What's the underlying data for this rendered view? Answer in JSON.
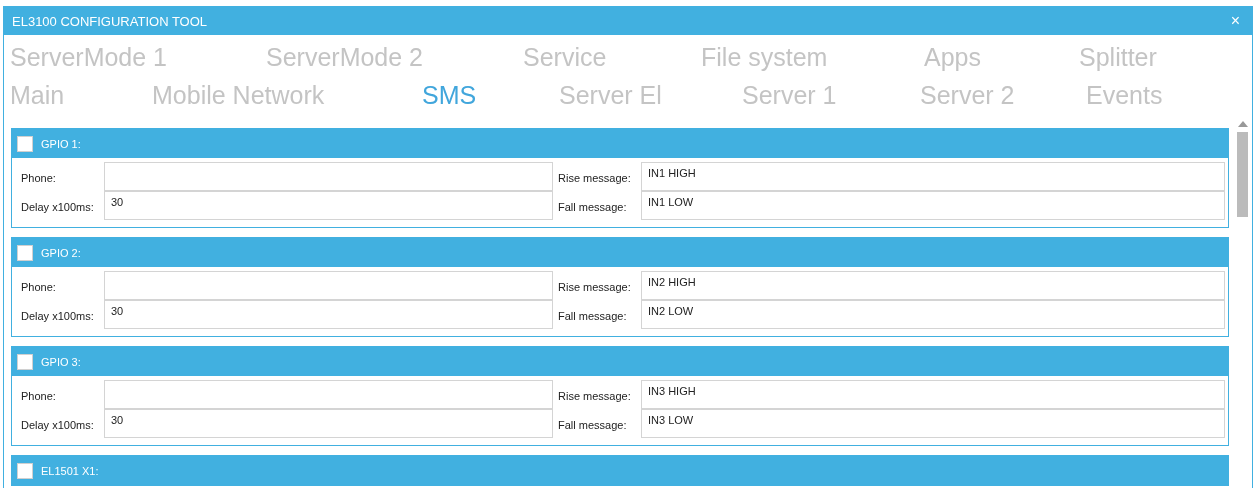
{
  "window": {
    "title": "EL3100 CONFIGURATION TOOL",
    "close": "×"
  },
  "tab_rows": [
    {
      "tabs": [
        {
          "label": "ServerMode 1",
          "selected": false
        },
        {
          "label": "ServerMode 2",
          "selected": false
        },
        {
          "label": "Service",
          "selected": false
        },
        {
          "label": "File system",
          "selected": false
        },
        {
          "label": "Apps",
          "selected": false
        },
        {
          "label": "Splitter",
          "selected": false
        }
      ]
    },
    {
      "tabs": [
        {
          "label": "Main",
          "selected": false
        },
        {
          "label": "Mobile Network",
          "selected": false
        },
        {
          "label": "SMS",
          "selected": true
        },
        {
          "label": "Server El",
          "selected": false
        },
        {
          "label": "Server 1",
          "selected": false
        },
        {
          "label": "Server 2",
          "selected": false
        },
        {
          "label": "Events",
          "selected": false
        }
      ]
    }
  ],
  "groups": [
    {
      "title": "GPIO 1:",
      "checked": false,
      "phone_label": "Phone:",
      "delay_label": "Delay x100ms:",
      "delay": "30",
      "rise_label": "Rise message:",
      "rise": "IN1 HIGH",
      "fall_label": "Fall message:",
      "fall": "IN1 LOW"
    },
    {
      "title": "GPIO 2:",
      "checked": false,
      "phone_label": "Phone:",
      "delay_label": "Delay x100ms:",
      "delay": "30",
      "rise_label": "Rise message:",
      "rise": "IN2 HIGH",
      "fall_label": "Fall message:",
      "fall": "IN2 LOW"
    },
    {
      "title": "GPIO 3:",
      "checked": false,
      "phone_label": "Phone:",
      "delay_label": "Delay x100ms:",
      "delay": "30",
      "rise_label": "Rise message:",
      "rise": "IN3 HIGH",
      "fall_label": "Fall message:",
      "fall": "IN3 LOW"
    },
    {
      "title": "EL1501 X1:",
      "checked": false
    }
  ]
}
